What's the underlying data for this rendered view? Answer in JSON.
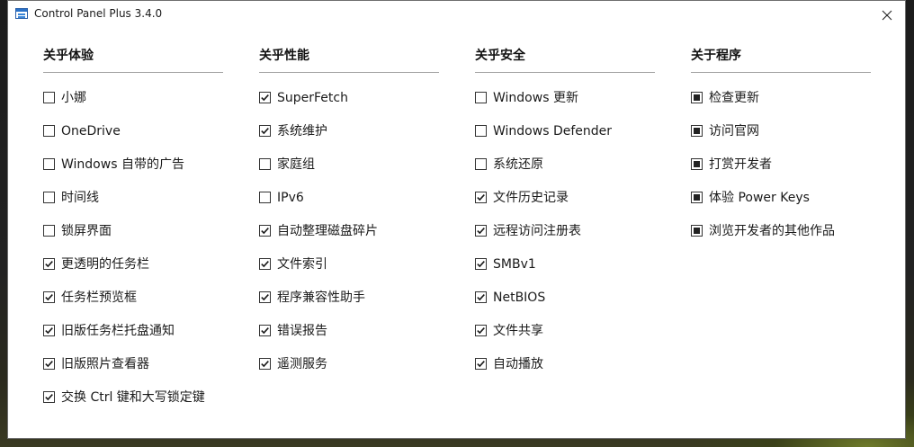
{
  "window": {
    "title": "Control Panel Plus 3.4.0",
    "close_label": "✕"
  },
  "columns": [
    {
      "header": "关乎体验",
      "items": [
        {
          "label": "小娜",
          "checked": false
        },
        {
          "label": "OneDrive",
          "checked": false
        },
        {
          "label": "Windows 自带的广告",
          "checked": false
        },
        {
          "label": "时间线",
          "checked": false
        },
        {
          "label": "锁屏界面",
          "checked": false
        },
        {
          "label": "更透明的任务栏",
          "checked": true
        },
        {
          "label": "任务栏预览框",
          "checked": true
        },
        {
          "label": "旧版任务栏托盘通知",
          "checked": true
        },
        {
          "label": "旧版照片查看器",
          "checked": true
        },
        {
          "label": "交换 Ctrl 键和大写锁定键",
          "checked": true
        }
      ]
    },
    {
      "header": "关乎性能",
      "items": [
        {
          "label": "SuperFetch",
          "checked": true
        },
        {
          "label": "系统维护",
          "checked": true
        },
        {
          "label": "家庭组",
          "checked": false
        },
        {
          "label": "IPv6",
          "checked": false
        },
        {
          "label": "自动整理磁盘碎片",
          "checked": true
        },
        {
          "label": "文件索引",
          "checked": true
        },
        {
          "label": "程序兼容性助手",
          "checked": true
        },
        {
          "label": "错误报告",
          "checked": true
        },
        {
          "label": "遥测服务",
          "checked": true
        }
      ]
    },
    {
      "header": "关乎安全",
      "items": [
        {
          "label": "Windows 更新",
          "checked": false
        },
        {
          "label": "Windows Defender",
          "checked": false
        },
        {
          "label": "系统还原",
          "checked": false
        },
        {
          "label": "文件历史记录",
          "checked": true
        },
        {
          "label": "远程访问注册表",
          "checked": true
        },
        {
          "label": "SMBv1",
          "checked": true
        },
        {
          "label": "NetBIOS",
          "checked": true
        },
        {
          "label": "文件共享",
          "checked": true
        },
        {
          "label": "自动播放",
          "checked": true
        }
      ]
    },
    {
      "header": "关于程序",
      "items": [
        {
          "label": "检查更新",
          "checked": "indeterminate"
        },
        {
          "label": "访问官网",
          "checked": "indeterminate"
        },
        {
          "label": "打赏开发者",
          "checked": "indeterminate"
        },
        {
          "label": "体验 Power Keys",
          "checked": "indeterminate"
        },
        {
          "label": "浏览开发者的其他作品",
          "checked": "indeterminate"
        }
      ]
    }
  ]
}
